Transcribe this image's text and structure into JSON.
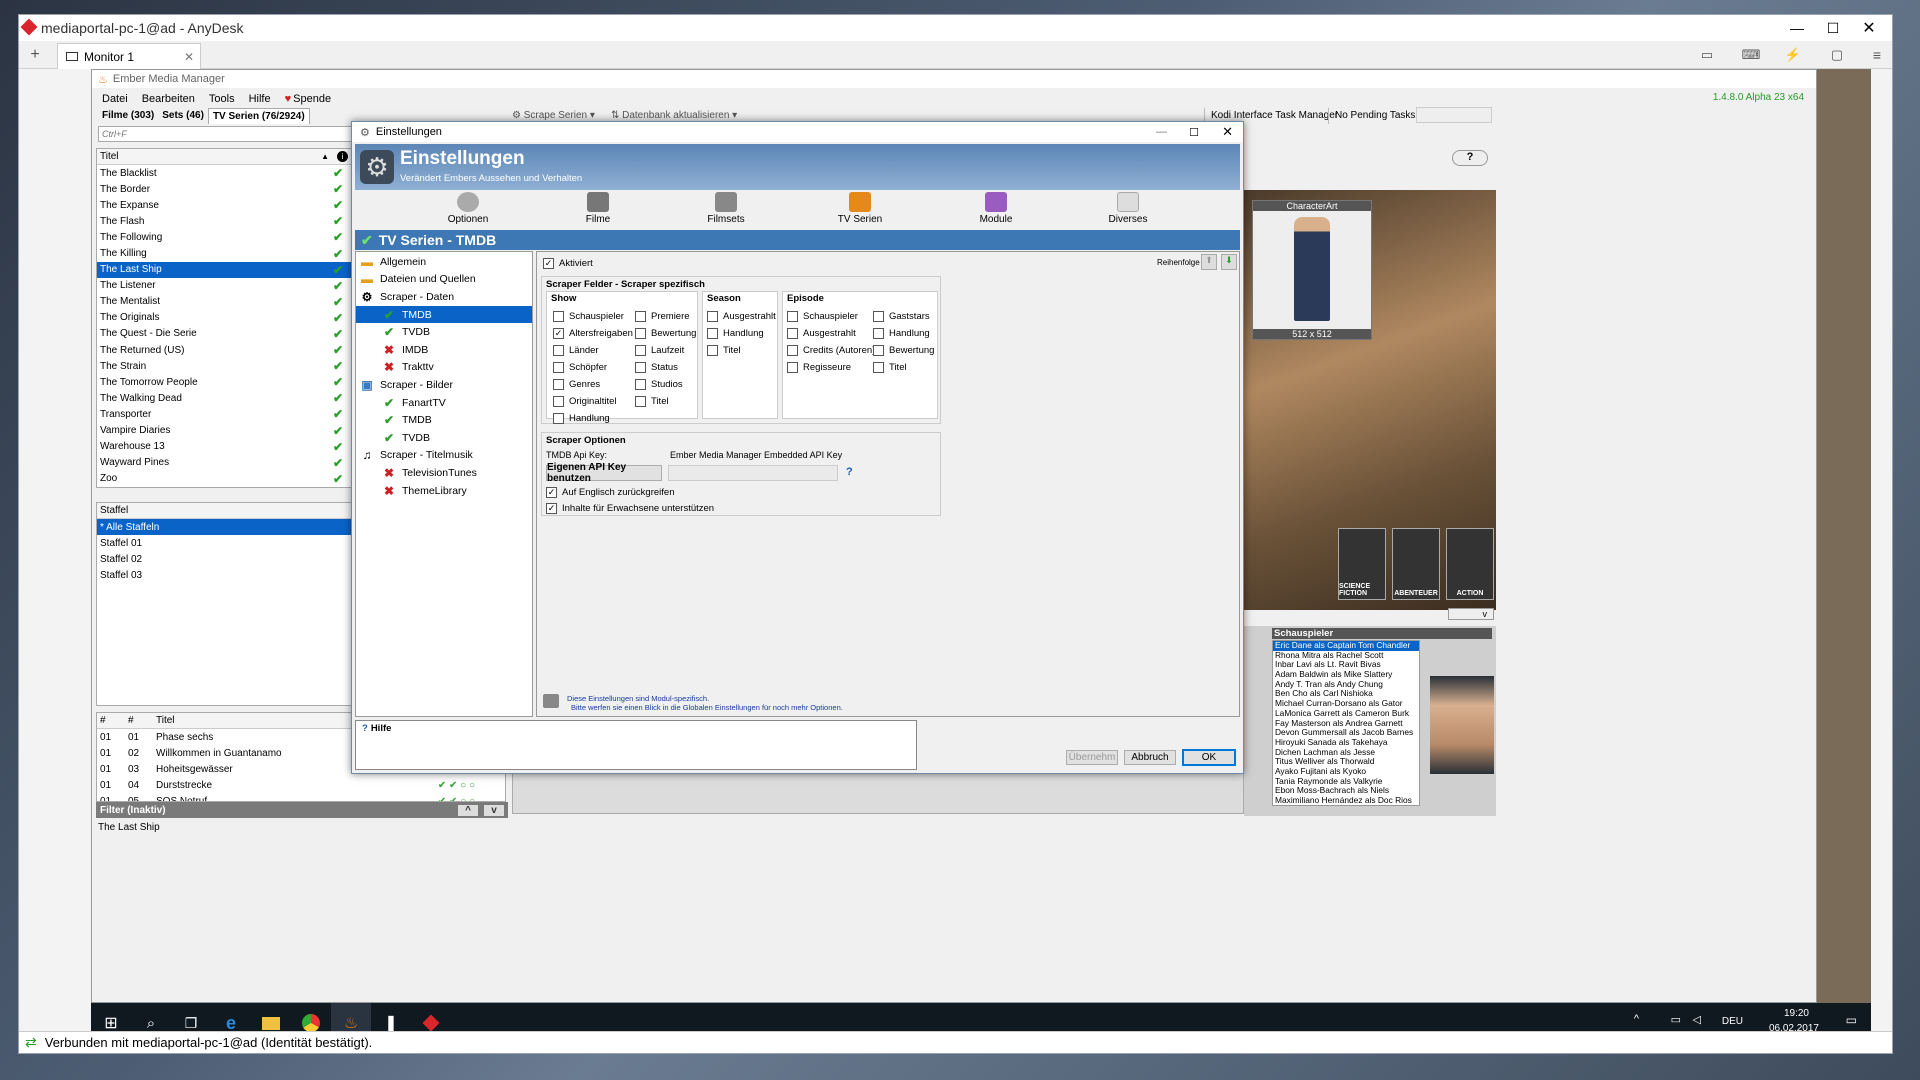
{
  "anydesk": {
    "title": "mediaportal-pc-1@ad - AnyDesk",
    "tab_label": "Monitor 1",
    "status_text": "Verbunden mit mediaportal-pc-1@ad (Identität bestätigt)."
  },
  "emm": {
    "title": "Ember Media Manager",
    "menu": [
      "Datei",
      "Bearbeiten",
      "Tools",
      "Hilfe",
      "Spende"
    ],
    "version": "1.4.8.0 Alpha 23 x64",
    "tabs": [
      "Filme (303)",
      "Sets (46)",
      "TV Serien (76/2924)"
    ],
    "toolbar": {
      "scrape": "Scrape Serien",
      "update": "Datenbank aktualisieren"
    },
    "kodi": "Kodi Interface Task Manager",
    "pending": "No Pending Tasks",
    "search_placeholder": "Ctrl+F",
    "list_header": "Titel",
    "shows": [
      "The Blacklist",
      "The Border",
      "The Expanse",
      "The Flash",
      "The Following",
      "The Killing",
      "The Last Ship",
      "The Listener",
      "The Mentalist",
      "The Originals",
      "The Quest - Die Serie",
      "The Returned (US)",
      "The Strain",
      "The Tomorrow People",
      "The Walking Dead",
      "Transporter",
      "Vampire Diaries",
      "Warehouse 13",
      "Wayward Pines",
      "Zoo"
    ],
    "selected_show_index": 6,
    "seasons_header": "Staffel",
    "seasons": [
      "* Alle Staffeln",
      "Staffel 01",
      "Staffel 02",
      "Staffel 03"
    ],
    "episodes_headers": [
      "#",
      "#",
      "Titel"
    ],
    "episodes": [
      {
        "s": "01",
        "e": "01",
        "t": "Phase sechs"
      },
      {
        "s": "01",
        "e": "02",
        "t": "Willkommen in Guantanamo"
      },
      {
        "s": "01",
        "e": "03",
        "t": "Hoheitsgewässer"
      },
      {
        "s": "01",
        "e": "04",
        "t": "Durststrecke"
      },
      {
        "s": "01",
        "e": "05",
        "t": "SOS Notruf"
      }
    ],
    "filter_label": "Filter (Inaktiv)",
    "footer_title": "The Last Ship",
    "characterart_label": "CharacterArt",
    "characterart_size": "512 x 512",
    "genres": [
      "SCIENCE FICTION",
      "ABENTEUER",
      "ACTION"
    ],
    "actors_header": "Schauspieler",
    "actors": [
      "Eric Dane als Captain Tom Chandler",
      "Rhona Mitra als Rachel Scott",
      "Inbar Lavi als Lt. Ravit Bivas",
      "Adam Baldwin als Mike Slattery",
      "Andy T. Tran als Andy Chung",
      "Ben Cho als Carl Nishioka",
      "Michael Curran-Dorsano als Gator",
      "LaMonica Garrett als Cameron Burk",
      "Fay Masterson als Andrea Garnett",
      "Devon Gummersall als Jacob Barnes",
      "Hiroyuki Sanada als Takehaya",
      "Dichen Lachman als Jesse",
      "Titus Welliver als Thorwald",
      "Ayako Fujitani als Kyoko",
      "Tania Raymonde als Valkyrie",
      "Ebon Moss-Bachrach als Niels",
      "Maximiliano Hernández als Doc Rios"
    ]
  },
  "dialog": {
    "title": "Einstellungen",
    "header_title": "Einstellungen",
    "header_subtitle": "Verändert Embers Aussehen und Verhalten",
    "toolbar": [
      "Optionen",
      "Filme",
      "Filmsets",
      "TV Serien",
      "Module",
      "Diverses"
    ],
    "section_title": "TV Serien - TMDB",
    "tree": [
      {
        "label": "Allgemein",
        "indent": 0,
        "icon": "folder-icon",
        "state": "none"
      },
      {
        "label": "Dateien und Quellen",
        "indent": 0,
        "icon": "folder-icon",
        "state": "none"
      },
      {
        "label": "Scraper - Daten",
        "indent": 0,
        "icon": "scraper-icon",
        "state": "none"
      },
      {
        "label": "TMDB",
        "indent": 1,
        "icon": "check-icon",
        "state": "ok",
        "selected": true
      },
      {
        "label": "TVDB",
        "indent": 1,
        "icon": "check-icon",
        "state": "ok"
      },
      {
        "label": "IMDB",
        "indent": 1,
        "icon": "cross-icon",
        "state": "no"
      },
      {
        "label": "Trakttv",
        "indent": 1,
        "icon": "cross-icon",
        "state": "no"
      },
      {
        "label": "Scraper - Bilder",
        "indent": 0,
        "icon": "image-icon",
        "state": "none"
      },
      {
        "label": "FanartTV",
        "indent": 1,
        "icon": "check-icon",
        "state": "ok"
      },
      {
        "label": "TMDB",
        "indent": 1,
        "icon": "check-icon",
        "state": "ok"
      },
      {
        "label": "TVDB",
        "indent": 1,
        "icon": "check-icon",
        "state": "ok"
      },
      {
        "label": "Scraper - Titelmusik",
        "indent": 0,
        "icon": "music-icon",
        "state": "none"
      },
      {
        "label": "TelevisionTunes",
        "indent": 1,
        "icon": "cross-icon",
        "state": "no"
      },
      {
        "label": "ThemeLibrary",
        "indent": 1,
        "icon": "cross-icon",
        "state": "no"
      }
    ],
    "aktiviert": "Aktiviert",
    "reihenfolge": "Reihenfolge",
    "fields_group": "Scraper Felder - Scraper spezifisch",
    "show_label": "Show",
    "show_col1": [
      {
        "l": "Schauspieler",
        "c": false
      },
      {
        "l": "Altersfreigaben",
        "c": true
      },
      {
        "l": "Länder",
        "c": false
      },
      {
        "l": "Schöpfer",
        "c": false
      },
      {
        "l": "Genres",
        "c": false
      },
      {
        "l": "Originaltitel",
        "c": false
      },
      {
        "l": "Handlung",
        "c": false
      }
    ],
    "show_col2": [
      {
        "l": "Premiere",
        "c": false
      },
      {
        "l": "Bewertung",
        "c": false
      },
      {
        "l": "Laufzeit",
        "c": false
      },
      {
        "l": "Status",
        "c": false
      },
      {
        "l": "Studios",
        "c": false
      },
      {
        "l": "Titel",
        "c": false
      }
    ],
    "season_label": "Season",
    "season_items": [
      {
        "l": "Ausgestrahlt",
        "c": false
      },
      {
        "l": "Handlung",
        "c": false
      },
      {
        "l": "Titel",
        "c": false
      }
    ],
    "episode_label": "Episode",
    "episode_col1": [
      {
        "l": "Schauspieler",
        "c": false
      },
      {
        "l": "Ausgestrahlt",
        "c": false
      },
      {
        "l": "Credits (Autoren)",
        "c": false
      },
      {
        "l": "Regisseure",
        "c": false
      }
    ],
    "episode_col2": [
      {
        "l": "Gaststars",
        "c": false
      },
      {
        "l": "Handlung",
        "c": false
      },
      {
        "l": "Bewertung",
        "c": false
      },
      {
        "l": "Titel",
        "c": false
      }
    ],
    "options_group": "Scraper Optionen",
    "api_label": "TMDB Api Key:",
    "api_value": "Ember Media Manager Embedded API Key",
    "own_api_button": "Eigenen API Key benutzen",
    "fallback_english": "Auf Englisch zurückgreifen",
    "adult_content": "Inhalte für Erwachsene unterstützen",
    "note_line1": "Diese Einstellungen sind Modul-spezifisch.",
    "note_line2": "Bitte werfen sie einen Blick in die Globalen Einstellungen für noch mehr Optionen.",
    "help_label": "Hilfe",
    "btn_apply": "Übernehm",
    "btn_cancel": "Abbruch",
    "btn_ok": "OK"
  },
  "taskbar": {
    "lang": "DEU",
    "time": "19:20",
    "date": "06.02.2017"
  },
  "colors": {
    "selection": "#0a64c8",
    "dialog_header": "#5c86b6",
    "ok": "#2aa12a",
    "error": "#d02020"
  }
}
